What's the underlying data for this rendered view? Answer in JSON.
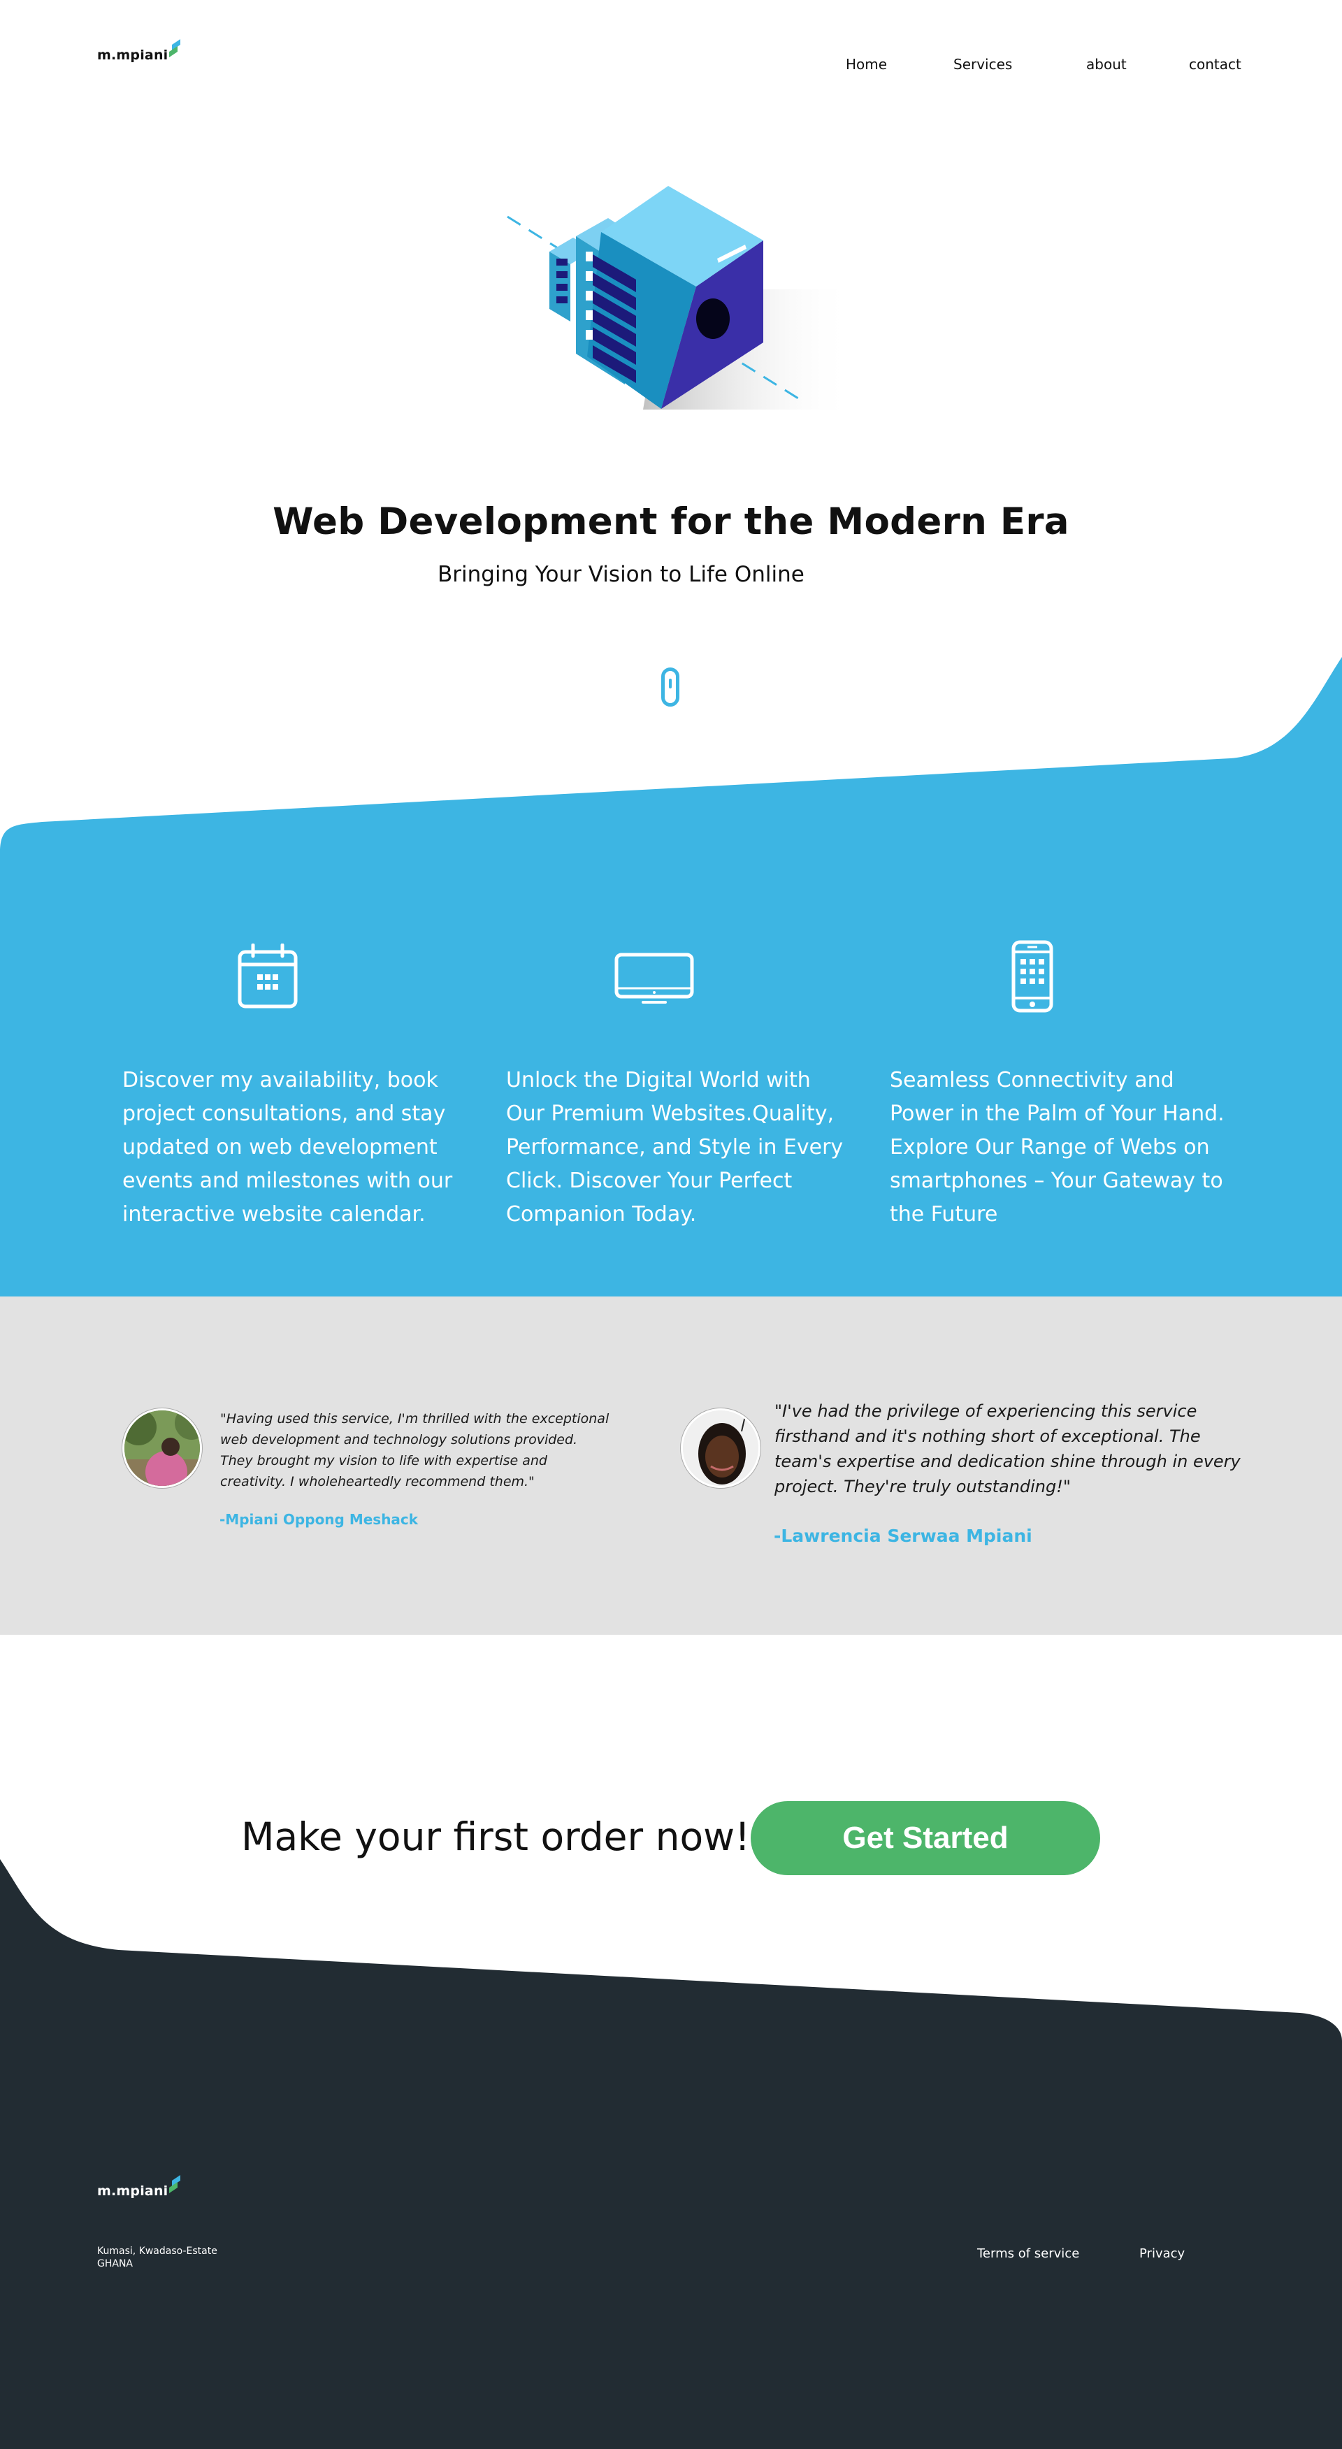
{
  "brand": {
    "name": "m.mpiani"
  },
  "nav": {
    "home": "Home",
    "services": "Services",
    "about": "about",
    "contact": "contact"
  },
  "hero": {
    "title": "Web Development for the Modern Era",
    "subtitle": "Bringing Your Vision to Life Online",
    "illustration_icon": "isometric-server-cube-icon",
    "scroll_icon": "mouse-scroll-icon"
  },
  "features": [
    {
      "icon": "calendar-icon",
      "text": "Discover my availability, book project consultations, and stay updated on web development events and milestones with our interactive website calendar."
    },
    {
      "icon": "monitor-icon",
      "text": "Unlock the Digital World with Our Premium Websites.Quality, Performance, and Style in Every Click. Discover Your Perfect Companion Today."
    },
    {
      "icon": "smartphone-icon",
      "text": "Seamless Connectivity and Power in the Palm of Your Hand. Explore Our Range of Webs on smartphones – Your Gateway to the Future"
    }
  ],
  "testimonials": [
    {
      "quote": "\"Having used this service, I'm thrilled with the exceptional web development and technology solutions provided. They brought my vision to life with expertise and creativity. I wholeheartedly recommend them.\"",
      "author": "-Mpiani Oppong Meshack"
    },
    {
      "quote": "\"I've had the privilege of experiencing this service firsthand and it's nothing short of exceptional. The team's expertise and dedication shine through in every project. They're truly outstanding!\"",
      "author": "-Lawrencia Serwaa Mpiani"
    }
  ],
  "cta": {
    "text": "Make your first order now!",
    "button": "Get Started"
  },
  "footer": {
    "address_line1": "Kumasi, Kwadaso-Estate",
    "address_line2": "GHANA",
    "terms": "Terms of service",
    "privacy": "Privacy"
  },
  "colors": {
    "accent_blue": "#3db5e3",
    "cta_green": "#4db56a",
    "footer_dark": "#222c33",
    "testimonial_bg": "#e2e2e2"
  }
}
